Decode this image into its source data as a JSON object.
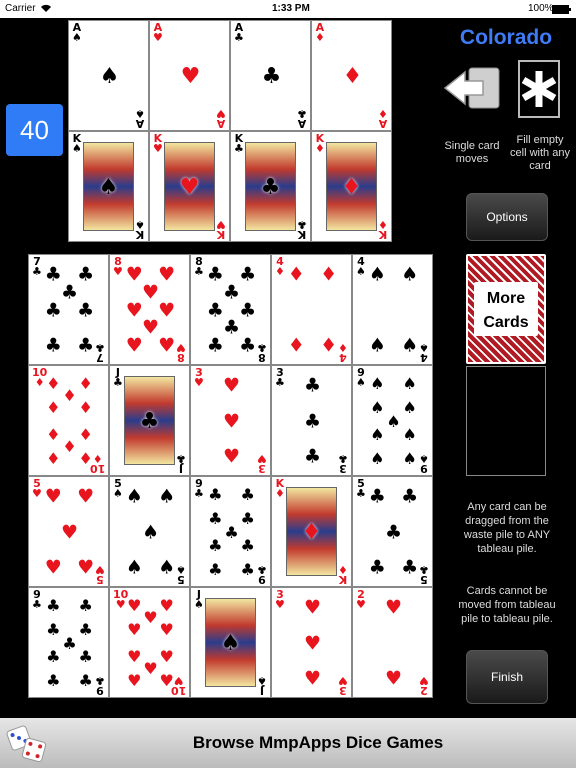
{
  "status_bar": {
    "carrier": "Carrier",
    "time": "1:33 PM",
    "battery": "100%"
  },
  "score": "40",
  "game_title": "Colorado",
  "modes": [
    {
      "label": "Single card moves",
      "icon": "single-card-move-icon"
    },
    {
      "label": "Fill empty cell with any card",
      "icon": "asterisk-icon"
    }
  ],
  "buttons": {
    "options": "Options",
    "finish": "Finish"
  },
  "stock": {
    "label_line1": "More",
    "label_line2": "Cards"
  },
  "info": {
    "line1": "Any card can be dragged from the waste pile to ANY tableau pile.",
    "line2": "Cards cannot be moved from tableau pile to tableau pile."
  },
  "banner": {
    "text": "Browse MmpApps Dice Games",
    "icon": "dice-icon"
  },
  "colors": {
    "accent": "#3f7bf5",
    "score_bg": "#2f7cf6",
    "red_suit": "#e8141e"
  },
  "foundations": [
    {
      "rank": "A",
      "suit": "♠"
    },
    {
      "rank": "A",
      "suit": "♥"
    },
    {
      "rank": "A",
      "suit": "♣"
    },
    {
      "rank": "A",
      "suit": "♦"
    },
    {
      "rank": "K",
      "suit": "♠"
    },
    {
      "rank": "K",
      "suit": "♥"
    },
    {
      "rank": "K",
      "suit": "♣"
    },
    {
      "rank": "K",
      "suit": "♦"
    }
  ],
  "tableau": [
    [
      {
        "rank": "7",
        "suit": "♣"
      },
      {
        "rank": "8",
        "suit": "♥"
      },
      {
        "rank": "8",
        "suit": "♣"
      },
      {
        "rank": "4",
        "suit": "♦"
      },
      {
        "rank": "4",
        "suit": "♠"
      }
    ],
    [
      {
        "rank": "10",
        "suit": "♦"
      },
      {
        "rank": "J",
        "suit": "♣"
      },
      {
        "rank": "3",
        "suit": "♥"
      },
      {
        "rank": "3",
        "suit": "♣"
      },
      {
        "rank": "9",
        "suit": "♠"
      }
    ],
    [
      {
        "rank": "5",
        "suit": "♥"
      },
      {
        "rank": "5",
        "suit": "♠"
      },
      {
        "rank": "9",
        "suit": "♣"
      },
      {
        "rank": "K",
        "suit": "♦"
      },
      {
        "rank": "5",
        "suit": "♣"
      }
    ],
    [
      {
        "rank": "9",
        "suit": "♣"
      },
      {
        "rank": "10",
        "suit": "♥"
      },
      {
        "rank": "J",
        "suit": "♠"
      },
      {
        "rank": "3",
        "suit": "♥"
      },
      {
        "rank": "2",
        "suit": "♥"
      }
    ]
  ]
}
